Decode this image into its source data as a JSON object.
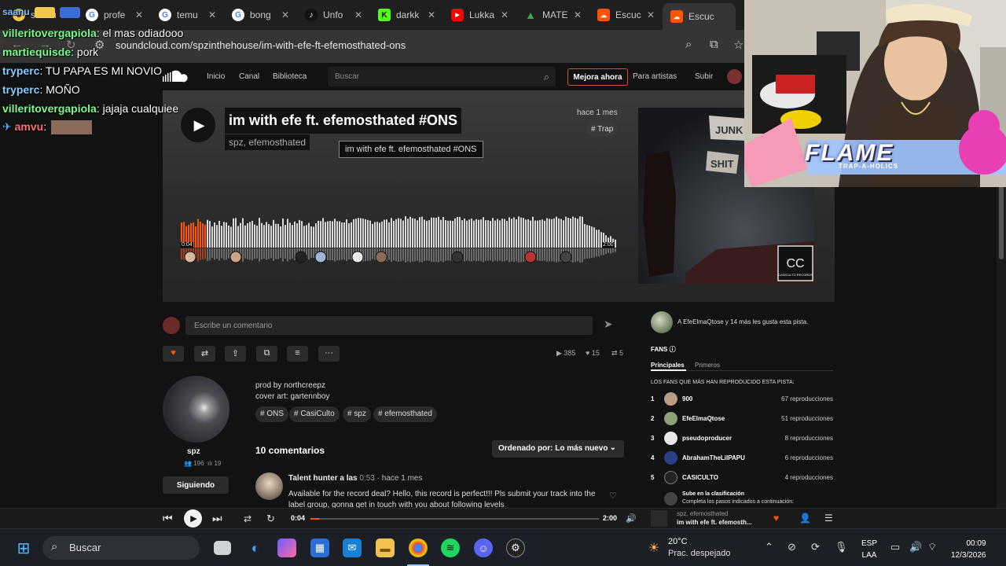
{
  "browser": {
    "tabs": [
      {
        "label": "saanu",
        "icon": "app-icon",
        "color": "#f2c94c"
      },
      {
        "label": "profe",
        "icon": "google-icon",
        "color": "#ffffff"
      },
      {
        "label": "temu",
        "icon": "google-icon",
        "color": "#ffffff"
      },
      {
        "label": "bong",
        "icon": "google-icon",
        "color": "#ffffff"
      },
      {
        "label": "Unfo",
        "icon": "tiktok-icon",
        "color": "#111111"
      },
      {
        "label": "darkk",
        "icon": "kick-icon",
        "color": "#53fc18"
      },
      {
        "label": "Lukka",
        "icon": "youtube-icon",
        "color": "#ff0000"
      },
      {
        "label": "MATE",
        "icon": "drive-icon",
        "color": "#34a853"
      },
      {
        "label": "Escuc",
        "icon": "soundcloud-icon",
        "color": "#ff5500"
      },
      {
        "label": "Escuc",
        "icon": "soundcloud-icon",
        "color": "#ff5500"
      }
    ],
    "url": "soundcloud.com/spzinthehouse/im-with-efe-ft-efemosthated-ons"
  },
  "header": {
    "nav": [
      "Inicio",
      "Canal",
      "Biblioteca"
    ],
    "search_placeholder": "Buscar",
    "upgrade": "Mejora ahora",
    "for_artists": "Para artistas",
    "upload": "Subir"
  },
  "track": {
    "title": "im with efe ft. efemosthated #ONS",
    "artist": "spz, efemosthated",
    "tooltip": "im with efe ft. efemosthated #ONS",
    "date": "hace 1 mes",
    "genre": "# Trap",
    "time_start": "0:04",
    "time_end": "2:00",
    "cover_label": "CASICULTO RECORDS",
    "cover_sign1": "JUNK",
    "cover_sign2": "SHIT"
  },
  "comment_box": {
    "placeholder": "Escribe un comentario"
  },
  "stats": {
    "plays": "385",
    "likes": "15",
    "reposts": "5"
  },
  "uploader": {
    "name": "spz",
    "followers": "196",
    "tracks": "19",
    "follow_label": "Siguiendo"
  },
  "description": [
    "prod by northcreepz",
    "cover art: gartennboy"
  ],
  "tags": [
    "# ONS",
    "# CasiCulto",
    "# spz",
    "# efemosthated"
  ],
  "comments": {
    "count_label": "10 comentarios",
    "sort_label": "Ordenado por: Lo más nuevo",
    "first": {
      "user": "Talent hunter a las",
      "time": "0:53",
      "ago": "· hace 1 mes",
      "text": "Available for the record deal? Hello, this record is perfect!!! Pls submit your track into the label group, gonna get in touch with you about following levels"
    }
  },
  "sidebar": {
    "likers_text": "A EfeElmaQtose y 14 más les gusta esta pista.",
    "fans_title": "FANS",
    "tab_main": "Principales",
    "tab_first": "Primeros",
    "fans_sub": "LOS FANS QUE MÁS HAN REPRODUCIDO ESTA PISTA:",
    "fans": [
      {
        "rank": "1",
        "name": "900",
        "plays": "67 reproducciones"
      },
      {
        "rank": "2",
        "name": "EfeElmaQtose",
        "plays": "51 reproducciones"
      },
      {
        "rank": "3",
        "name": "pseudoproducer",
        "plays": "8 reproducciones"
      },
      {
        "rank": "4",
        "name": "AbrahamTheLilPAPU",
        "plays": "6 reproducciones"
      },
      {
        "rank": "5",
        "name": "CASICULTO",
        "plays": "4 reproducciones"
      }
    ],
    "rank_title": "Sube en la clasificación",
    "rank_sub": "Completa los pasos indicados a continuación:"
  },
  "player": {
    "time_current": "0:04",
    "time_total": "2:00",
    "progress": 0.03,
    "artist": "spz, efemosthated",
    "title": "im with efe ft. efemosth..."
  },
  "taskbar": {
    "search": "Buscar",
    "temp": "20°C",
    "weather": "Prac. despejado",
    "lang1": "ESP",
    "lang2": "LAA",
    "time": "00:09",
    "date": "12/3/2026"
  },
  "chat": [
    {
      "user": "saanu",
      "text": ""
    },
    {
      "user": "villeritovergapiola",
      "text": ": el mas odiadooo"
    },
    {
      "user": "martiequisde",
      "text": ": pork"
    },
    {
      "user": "tryperc",
      "text": ": TU PAPA ES MI NOVIO"
    },
    {
      "user": "tryperc",
      "text": ": MOÑO"
    },
    {
      "user": "villeritovergapiola",
      "text": ": jajaja cualquiee"
    },
    {
      "user": "amvu",
      "text": ":"
    }
  ],
  "overlay": {
    "flame": "FLAME",
    "flame_sub": "TRAP-A-HOLICS"
  },
  "colors": {
    "accent": "#ff5500",
    "chat_user": "#7CFC8F"
  }
}
